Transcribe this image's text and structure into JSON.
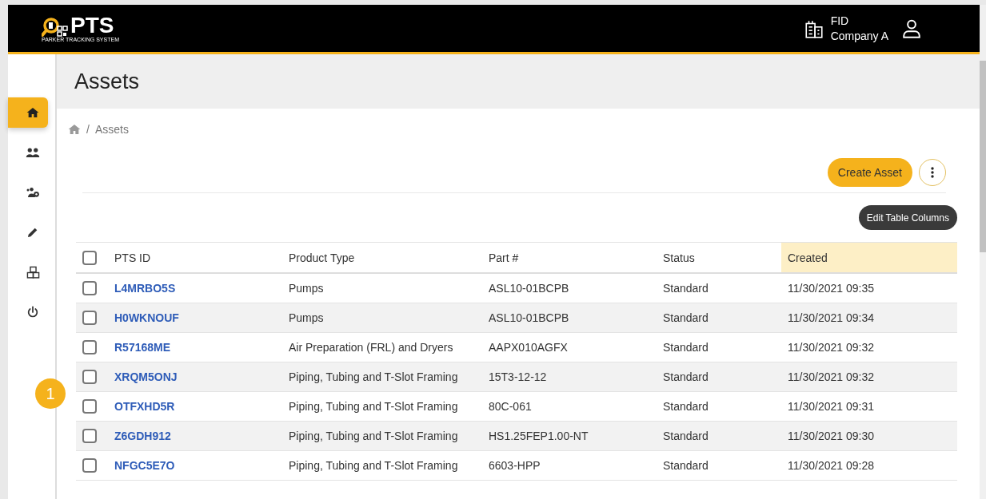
{
  "header": {
    "logo_text": "PTS",
    "logo_subtitle": "PARKER TRACKING SYSTEM",
    "company_code": "FID",
    "company_name": "Company A"
  },
  "sidebar": {
    "items": [
      {
        "kind": "home",
        "selected": true
      },
      {
        "kind": "users",
        "selected": false
      },
      {
        "kind": "team",
        "selected": false
      },
      {
        "kind": "edit",
        "selected": false
      },
      {
        "kind": "products",
        "selected": false
      },
      {
        "kind": "logout",
        "selected": false
      }
    ]
  },
  "page": {
    "title": "Assets",
    "breadcrumb_separator": "/",
    "breadcrumb": [
      "Assets"
    ]
  },
  "actions": {
    "create": "Create Asset",
    "edit_columns": "Edit Table Columns"
  },
  "table": {
    "select_all_checked": false,
    "columns": [
      {
        "label": "PTS ID",
        "sorted": false
      },
      {
        "label": "Product Type",
        "sorted": false
      },
      {
        "label": "Part #",
        "sorted": false
      },
      {
        "label": "Status",
        "sorted": false
      },
      {
        "label": "Created",
        "sorted": true
      }
    ],
    "rows": [
      {
        "checked": false,
        "cells": [
          "L4MRBO5S",
          "Pumps",
          "ASL10-01BCPB",
          "Standard",
          "11/30/2021 09:35"
        ]
      },
      {
        "checked": false,
        "cells": [
          "H0WKNOUF",
          "Pumps",
          "ASL10-01BCPB",
          "Standard",
          "11/30/2021 09:34"
        ]
      },
      {
        "checked": false,
        "cells": [
          "R57168ME",
          "Air Preparation (FRL) and Dryers",
          "AAPX010AGFX",
          "Standard",
          "11/30/2021 09:32"
        ]
      },
      {
        "checked": false,
        "cells": [
          "XRQM5ONJ",
          "Piping, Tubing and T-Slot Framing",
          "15T3-12-12",
          "Standard",
          "11/30/2021 09:32"
        ]
      },
      {
        "checked": false,
        "cells": [
          "OTFXHD5R",
          "Piping, Tubing and T-Slot Framing",
          "80C-061",
          "Standard",
          "11/30/2021 09:31"
        ]
      },
      {
        "checked": false,
        "cells": [
          "Z6GDH912",
          "Piping, Tubing and T-Slot Framing",
          "HS1.25FEP1.00-NT",
          "Standard",
          "11/30/2021 09:30"
        ]
      },
      {
        "checked": false,
        "cells": [
          "NFGC5E7O",
          "Piping, Tubing and T-Slot Framing",
          "6603-HPP",
          "Standard",
          "11/30/2021 09:28"
        ]
      }
    ]
  },
  "callout": {
    "label": "1"
  }
}
